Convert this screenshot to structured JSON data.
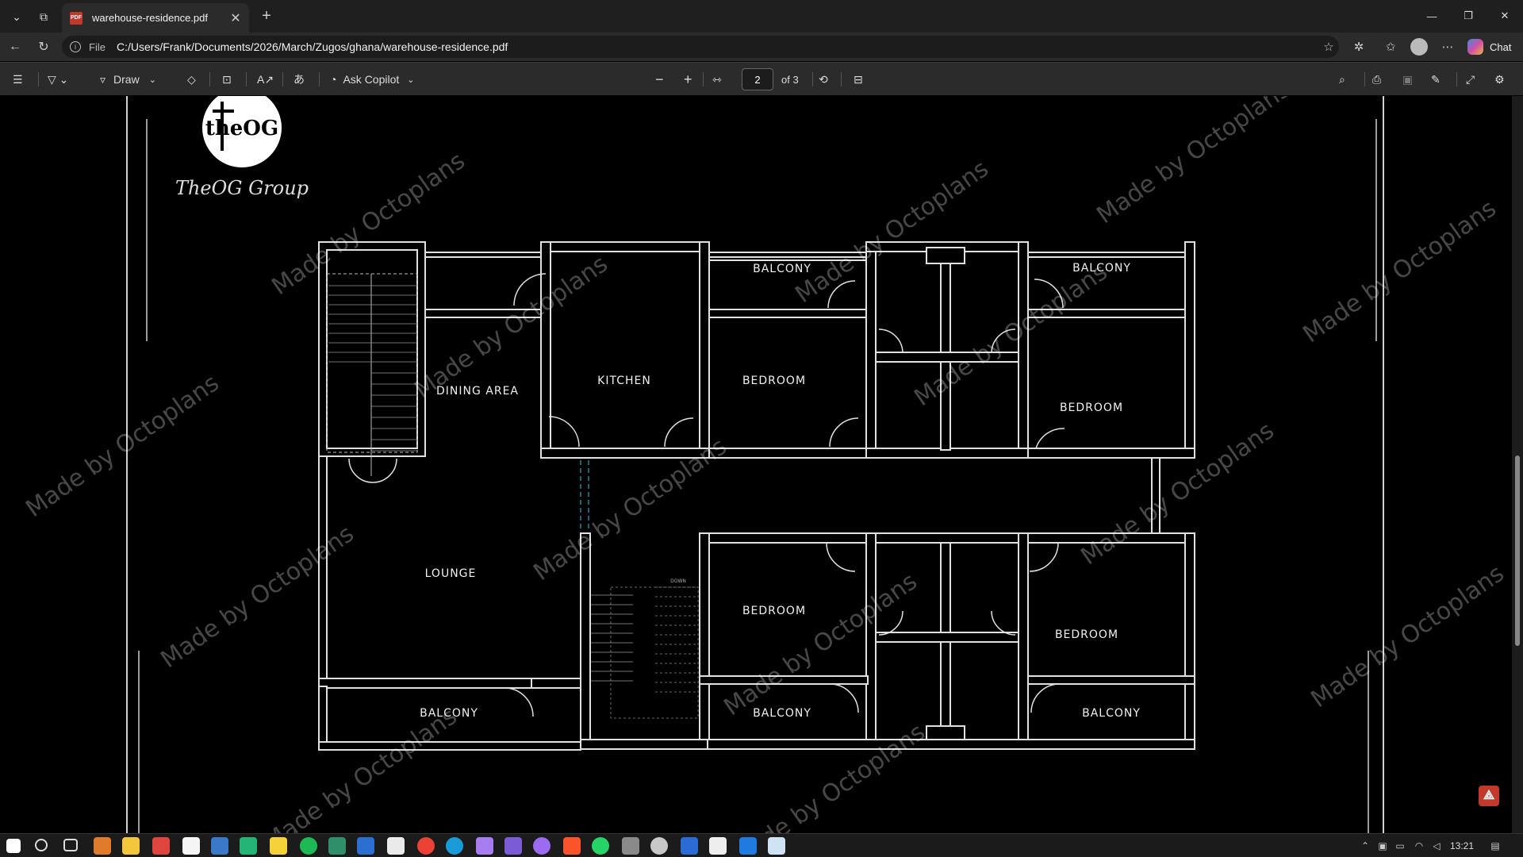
{
  "browser": {
    "tab_title": "warehouse-residence.pdf",
    "address_scheme": "File",
    "url": "C:/Users/Frank/Documents/2026/March/Zugos/ghana/warehouse-residence.pdf",
    "chat_label": "Chat"
  },
  "pdf_toolbar": {
    "draw_label": "Draw",
    "ask_copilot_label": "Ask Copilot",
    "current_page": "2",
    "page_of": "of 3"
  },
  "drawing": {
    "logo_text": "theOG",
    "brand_script": "TheOG Group",
    "watermark": "Made by Octoplans",
    "rooms": {
      "dining_area": "DINING AREA",
      "kitchen": "KITCHEN",
      "balcony_top_1": "BALCONY",
      "bedroom_top_1": "BEDROOM",
      "balcony_top_2": "BALCONY",
      "bedroom_top_2": "BEDROOM",
      "lounge": "LOUNGE",
      "bedroom_bottom_1": "BEDROOM",
      "bedroom_bottom_2": "BEDROOM",
      "balcony_bottom_1": "BALCONY",
      "balcony_bottom_2": "BALCONY",
      "balcony_bottom_3": "BALCONY",
      "stair_label": "DOWN"
    }
  },
  "taskbar": {
    "time": "13:21"
  },
  "colors": {
    "wall_fill": "#d9d9d9",
    "chrome_dark": "#1f1f1f",
    "toolbar": "#2b2b2b",
    "accent_stair": "#2aa6b8",
    "pdf_red": "#c0392b"
  }
}
